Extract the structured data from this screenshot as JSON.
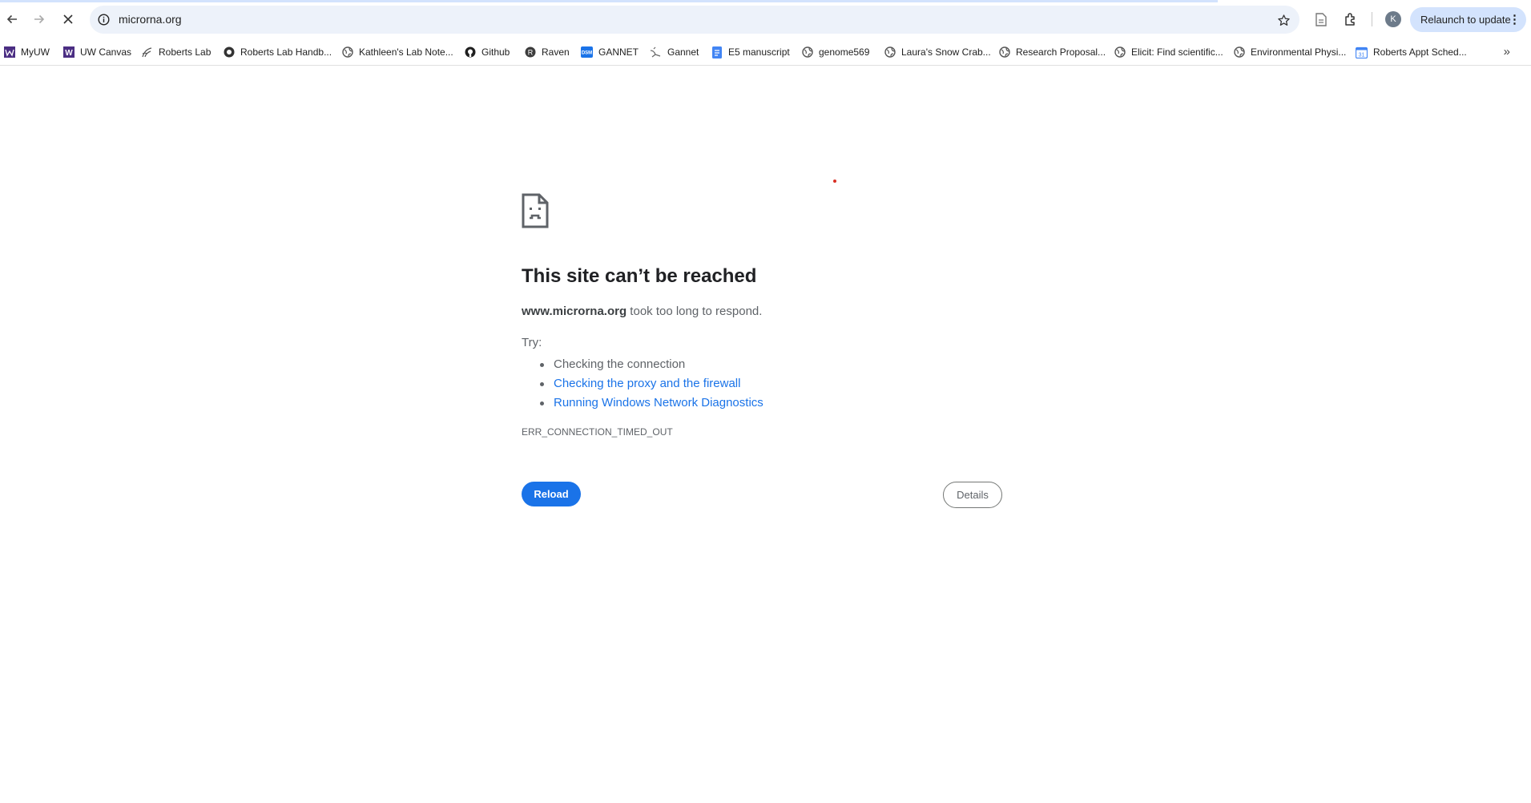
{
  "browser": {
    "url": "microrna.org",
    "relaunch_label": "Relaunch to update",
    "avatar_letter": "K",
    "accent_color": "#1a73e8"
  },
  "bookmarks": [
    {
      "label": "MyUW",
      "icon": "uw-icon"
    },
    {
      "label": "UW Canvas",
      "icon": "uw-w-icon"
    },
    {
      "label": "Roberts Lab",
      "icon": "robertslab-icon"
    },
    {
      "label": "Roberts Lab Handb...",
      "icon": "globe-dark-icon"
    },
    {
      "label": "Kathleen's Lab Note...",
      "icon": "globe-icon"
    },
    {
      "label": "Github",
      "icon": "github-icon"
    },
    {
      "label": "Raven",
      "icon": "raven-icon"
    },
    {
      "label": "GANNET",
      "icon": "dsm-icon"
    },
    {
      "label": "Gannet",
      "icon": "bird-icon"
    },
    {
      "label": "E5 manuscript",
      "icon": "docs-icon"
    },
    {
      "label": "genome569",
      "icon": "globe-icon"
    },
    {
      "label": "Laura's Snow Crab...",
      "icon": "globe-icon"
    },
    {
      "label": "Research Proposal...",
      "icon": "globe-icon"
    },
    {
      "label": "Elicit: Find scientific...",
      "icon": "globe-icon"
    },
    {
      "label": "Environmental Physi...",
      "icon": "globe-icon"
    },
    {
      "label": "Roberts Appt Sched...",
      "icon": "calendar-icon"
    }
  ],
  "error": {
    "title": "This site can’t be reached",
    "host": "www.microrna.org",
    "desc_rest": " took too long to respond.",
    "try_label": "Try:",
    "suggestions": [
      "Checking the connection",
      "Checking the proxy and the firewall",
      "Running Windows Network Diagnostics"
    ],
    "code": "ERR_CONNECTION_TIMED_OUT",
    "reload_label": "Reload",
    "details_label": "Details"
  }
}
